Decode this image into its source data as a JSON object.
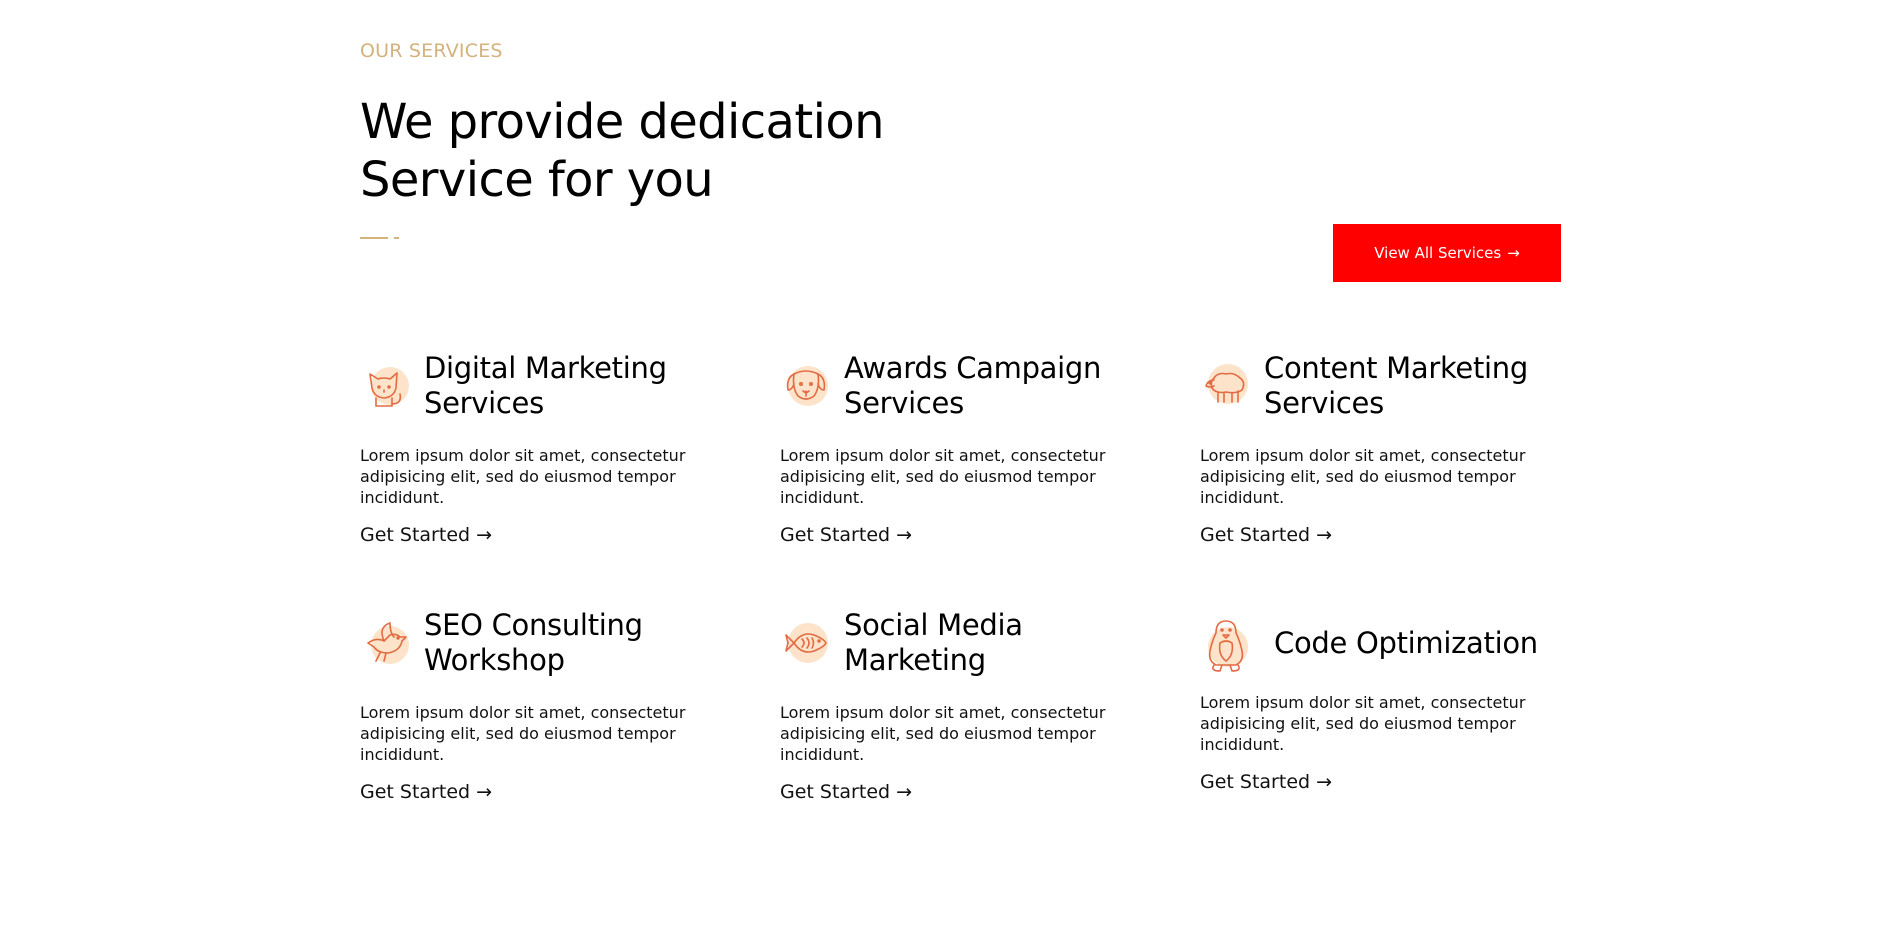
{
  "section": {
    "eyebrow": "OUR SERVICES",
    "headline_line1": "We provide dedication",
    "headline_line2": "Service for you",
    "view_all_label": "View All Services",
    "arrow": "→"
  },
  "colors": {
    "accent_gold": "#d4b27d",
    "button_red": "#ff0000",
    "icon_blob": "#fde3c9",
    "icon_stroke": "#e26b43"
  },
  "services": [
    {
      "title_line1": "Digital Marketing",
      "title_line2": "Services",
      "icon": "cat-icon",
      "description": "Lorem ipsum dolor sit amet, consectetur adipisicing elit, sed do eiusmod tempor incididunt.",
      "link_label": "Get Started"
    },
    {
      "title_line1": "Awards Campaign",
      "title_line2": "Services",
      "icon": "dog-icon",
      "description": "Lorem ipsum dolor sit amet, consectetur adipisicing elit, sed do eiusmod tempor incididunt.",
      "link_label": "Get Started"
    },
    {
      "title_line1": "Content Marketing",
      "title_line2": "Services",
      "icon": "sheep-icon",
      "description": "Lorem ipsum dolor sit amet, consectetur adipisicing elit, sed do eiusmod tempor incididunt.",
      "link_label": "Get Started"
    },
    {
      "title_line1": "SEO Consulting",
      "title_line2": "Workshop",
      "icon": "bird-icon",
      "description": "Lorem ipsum dolor sit amet, consectetur adipisicing elit, sed do eiusmod tempor incididunt.",
      "link_label": "Get Started"
    },
    {
      "title_line1": "Social Media",
      "title_line2": "Marketing",
      "icon": "fish-icon",
      "description": "Lorem ipsum dolor sit amet, consectetur adipisicing elit, sed do eiusmod tempor incididunt.",
      "link_label": "Get Started"
    },
    {
      "title_line1": "Code Optimization",
      "title_line2": "",
      "icon": "penguin-icon",
      "description": "Lorem ipsum dolor sit amet, consectetur adipisicing elit, sed do eiusmod tempor incididunt.",
      "link_label": "Get Started"
    }
  ]
}
